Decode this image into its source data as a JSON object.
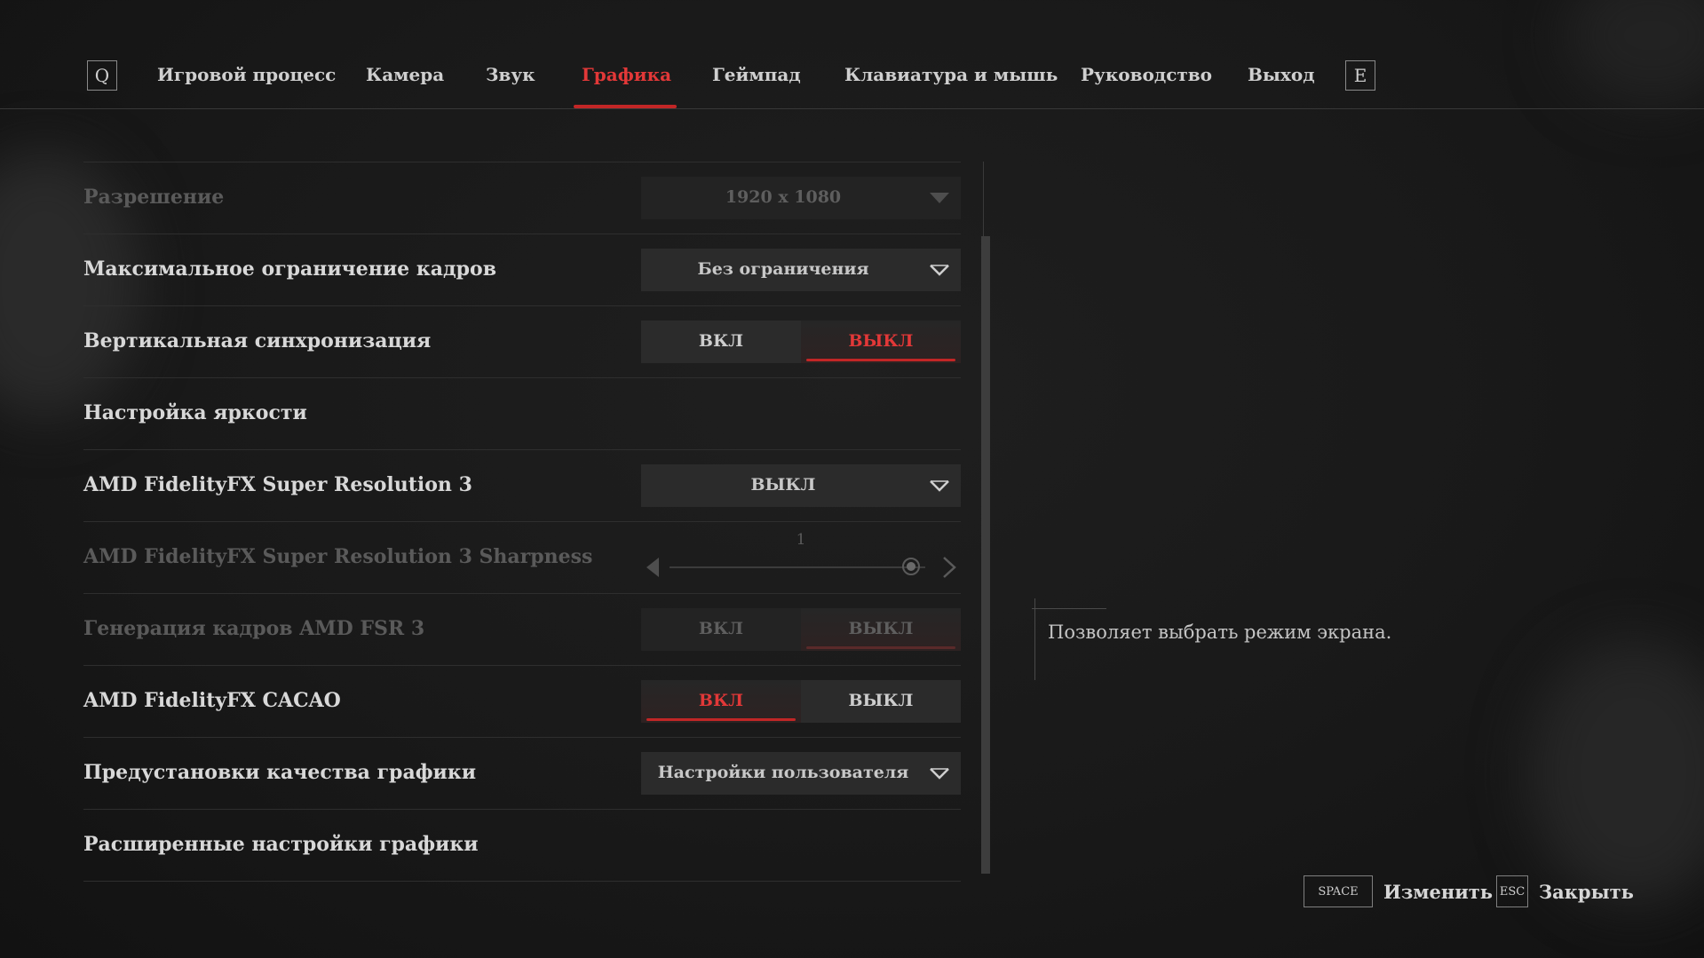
{
  "colors": {
    "accent": "#e23838",
    "background": "#191919",
    "control_bg": "#2b2b2b"
  },
  "nav": {
    "prev_key": "Q",
    "next_key": "E",
    "tabs": [
      {
        "label": "Игровой процесс"
      },
      {
        "label": "Камера"
      },
      {
        "label": "Звук"
      },
      {
        "label": "Графика",
        "active": true
      },
      {
        "label": "Геймпад"
      },
      {
        "label": "Клавиатура и мышь"
      },
      {
        "label": "Руководство"
      },
      {
        "label": "Выход"
      }
    ]
  },
  "settings": [
    {
      "label": "Разрешение",
      "type": "dropdown",
      "value": "1920 x 1080",
      "enabled": false
    },
    {
      "label": "Максимальное ограничение кадров",
      "type": "dropdown",
      "value": "Без ограничения",
      "enabled": true
    },
    {
      "label": "Вертикальная синхронизация",
      "type": "toggle",
      "on_label": "ВКЛ",
      "off_label": "ВЫКЛ",
      "selected": "ВЫКЛ",
      "enabled": true
    },
    {
      "label": "Настройка яркости",
      "type": "link",
      "enabled": true
    },
    {
      "label": "AMD FidelityFX Super Resolution 3",
      "type": "dropdown",
      "value": "ВЫКЛ",
      "enabled": true
    },
    {
      "label": "AMD FidelityFX Super Resolution 3 Sharpness",
      "type": "slider",
      "value": "1",
      "level": 1.0,
      "enabled": false
    },
    {
      "label": "Генерация кадров AMD FSR 3",
      "type": "toggle",
      "on_label": "ВКЛ",
      "off_label": "ВЫКЛ",
      "selected": "ВЫКЛ",
      "enabled": false
    },
    {
      "label": "AMD FidelityFX CACAO",
      "type": "toggle",
      "on_label": "ВКЛ",
      "off_label": "ВЫКЛ",
      "selected": "ВКЛ",
      "enabled": true
    },
    {
      "label": "Предустановки качества графики",
      "type": "dropdown",
      "value": "Настройки пользователя",
      "enabled": true
    },
    {
      "label": "Расширенные настройки графики",
      "type": "link",
      "enabled": true
    }
  ],
  "description": {
    "text": "Позволяет выбрать режим экрана."
  },
  "footer": {
    "change_key": "SPACE",
    "change_label": "Изменить",
    "close_key": "ESC",
    "close_label": "Закрыть"
  },
  "icons": {
    "dropdown": "chevron-down-icon",
    "slider_left": "arrow-left-icon",
    "slider_right": "arrow-right-icon"
  }
}
